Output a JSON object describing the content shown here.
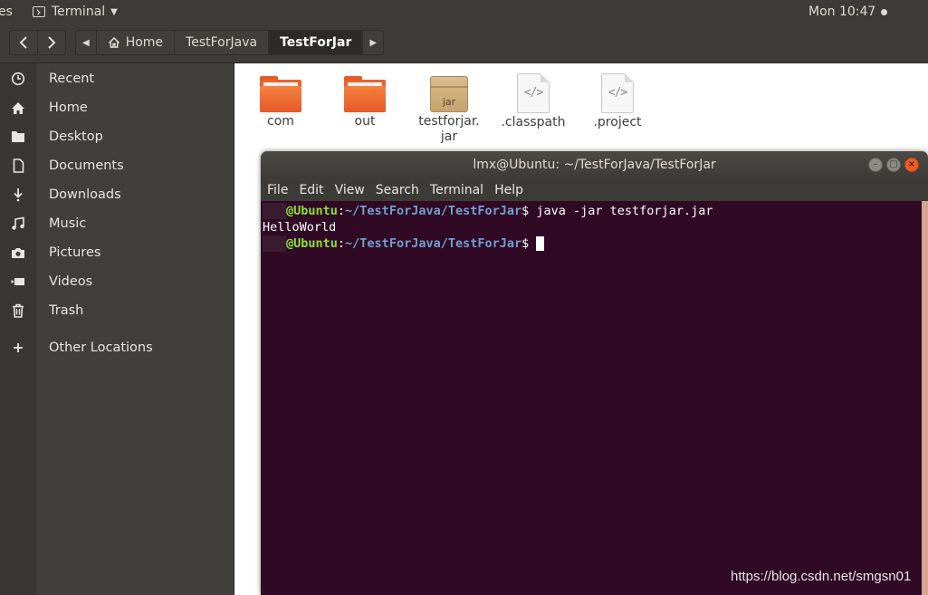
{
  "topbar": {
    "activities_label": "es",
    "app_menu_label": "Terminal",
    "clock": "Mon 10:47"
  },
  "header": {
    "breadcrumbs": [
      "Home",
      "TestForJava",
      "TestForJar"
    ],
    "active_crumb": "TestForJar"
  },
  "sidebar": {
    "items": [
      {
        "label": "Recent",
        "icon": "clock-icon"
      },
      {
        "label": "Home",
        "icon": "home-icon"
      },
      {
        "label": "Desktop",
        "icon": "folder-icon"
      },
      {
        "label": "Documents",
        "icon": "document-icon"
      },
      {
        "label": "Downloads",
        "icon": "download-icon"
      },
      {
        "label": "Music",
        "icon": "music-icon"
      },
      {
        "label": "Pictures",
        "icon": "camera-icon"
      },
      {
        "label": "Videos",
        "icon": "video-icon"
      },
      {
        "label": "Trash",
        "icon": "trash-icon"
      },
      {
        "label": "Other Locations",
        "icon": "plus-icon"
      }
    ]
  },
  "files": [
    {
      "name": "com",
      "icon": "folder-icon"
    },
    {
      "name": "out",
      "icon": "folder-icon"
    },
    {
      "name_line1": "testforjar.",
      "name_line2": "jar",
      "icon": "jar-archive-icon",
      "icon_text": "jar"
    },
    {
      "name": ".classpath",
      "icon": "code-file-icon",
      "icon_text": "</>"
    },
    {
      "name": ".project",
      "icon": "code-file-icon",
      "icon_text": "</>"
    }
  ],
  "terminal": {
    "title": "lmx@Ubuntu: ~/TestForJava/TestForJar",
    "menu": [
      "File",
      "Edit",
      "View",
      "Search",
      "Terminal",
      "Help"
    ],
    "prompt_host": "@Ubuntu",
    "prompt_sep": ":",
    "prompt_path": "~/TestForJava/TestForJar",
    "prompt_end": "$ ",
    "command": "java -jar testforjar.jar",
    "output": "HelloWorld"
  },
  "watermark": "https://blog.csdn.net/smgsn01",
  "colors": {
    "terminal_bg": "#300a24",
    "prompt_user_host": "#8ae234",
    "prompt_path": "#729fcf",
    "folder_orange": "#e8642f",
    "close_button": "#ec5d2b"
  }
}
